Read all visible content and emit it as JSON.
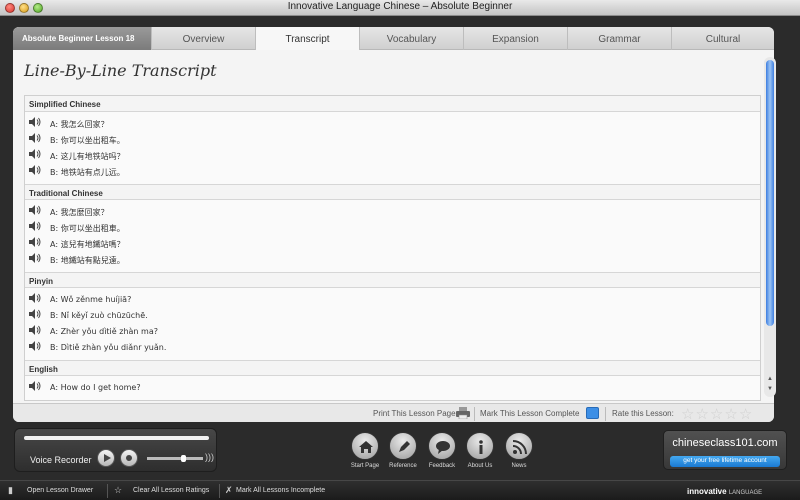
{
  "window": {
    "title": "Innovative Language Chinese – Absolute Beginner"
  },
  "lesson_tab": "Absolute Beginner Lesson 18",
  "tabs": [
    {
      "label": "Overview"
    },
    {
      "label": "Transcript"
    },
    {
      "label": "Vocabulary"
    },
    {
      "label": "Expansion"
    },
    {
      "label": "Grammar"
    },
    {
      "label": "Cultural"
    }
  ],
  "active_tab": "Transcript",
  "page_title": "Line-By-Line Transcript",
  "sections": [
    {
      "title": "Simplified Chinese",
      "lines": [
        "A: 我怎么回家？",
        "B: 你可以坐出租车。",
        "A: 这儿有地铁站吗？",
        "B: 地铁站有点儿远。"
      ]
    },
    {
      "title": "Traditional Chinese",
      "lines": [
        "A: 我怎麼回家？",
        "B: 你可以坐出租車。",
        "A: 這兒有地鐵站嗎？",
        "B: 地鐵站有點兒遠。"
      ]
    },
    {
      "title": "Pinyin",
      "lines": [
        "A: Wǒ zěnme huíjiā?",
        "B: Nǐ kěyǐ zuò chūzūchē.",
        "A: Zhèr yǒu dìtiě zhàn ma?",
        "B: Dìtiě zhàn yǒu diǎnr yuǎn."
      ]
    },
    {
      "title": "English",
      "lines": [
        "A: How do I get home?"
      ]
    }
  ],
  "panel_footer": {
    "print": "Print This Lesson Page",
    "mark_complete": "Mark This Lesson Complete",
    "rate": "Rate this Lesson:",
    "rating": 0,
    "max_rating": 5
  },
  "recorder": {
    "label": "Voice Recorder"
  },
  "nav": [
    {
      "label": "Start Page",
      "icon": "house-icon"
    },
    {
      "label": "Reference",
      "icon": "pen-icon"
    },
    {
      "label": "Feedback",
      "icon": "speech-bubble-icon"
    },
    {
      "label": "About Us",
      "icon": "info-icon"
    },
    {
      "label": "News",
      "icon": "rss-icon"
    }
  ],
  "brand": {
    "name": "chineseclass101.com",
    "cta": "get your free lifetime account"
  },
  "bottombar": {
    "open_drawer": "Open Lesson Drawer",
    "clear_ratings": "Clear All Lesson Ratings",
    "mark_incomplete": "Mark All Lessons Incomplete",
    "logo_main": "innovative",
    "logo_sub": "LANGUAGE"
  },
  "colors": {
    "accent": "#3d7ee0",
    "cta": "#1a7ad2"
  }
}
